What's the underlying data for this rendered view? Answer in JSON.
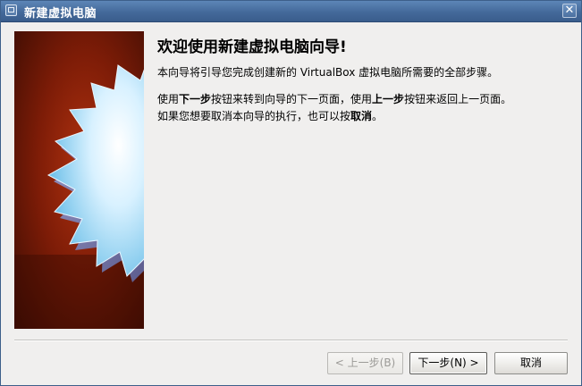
{
  "window": {
    "title": "新建虚拟电脑",
    "close_glyph": "✕"
  },
  "content": {
    "heading": "欢迎使用新建虚拟电脑向导!",
    "paragraph1": "本向导将引导您完成创建新的 VirtualBox 虚拟电脑所需要的全部步骤。",
    "paragraph2_line1": {
      "pre": "使用",
      "bold1": "下一步",
      "mid": "按钮来转到向导的下一页面，使用",
      "bold2": "上一步",
      "post": "按钮来返回上一页面。"
    },
    "paragraph2_line2": {
      "pre": "如果您想要取消本向导的执行，也可以按",
      "bold": "取消",
      "post": "。"
    }
  },
  "buttons": {
    "back": {
      "label": "< 上一步(B)",
      "enabled": false
    },
    "next": {
      "label": "下一步(N) >",
      "enabled": true,
      "default": true
    },
    "cancel": {
      "label": "取消",
      "enabled": true
    }
  },
  "icons": {
    "title_icon": "virtualbox-window-icon",
    "close": "close-icon",
    "banner": "starburst-banner-image"
  },
  "colors": {
    "titlebar": "#44699a",
    "banner_bg": "#7a1a08",
    "starburst": "#bfe6ff"
  }
}
